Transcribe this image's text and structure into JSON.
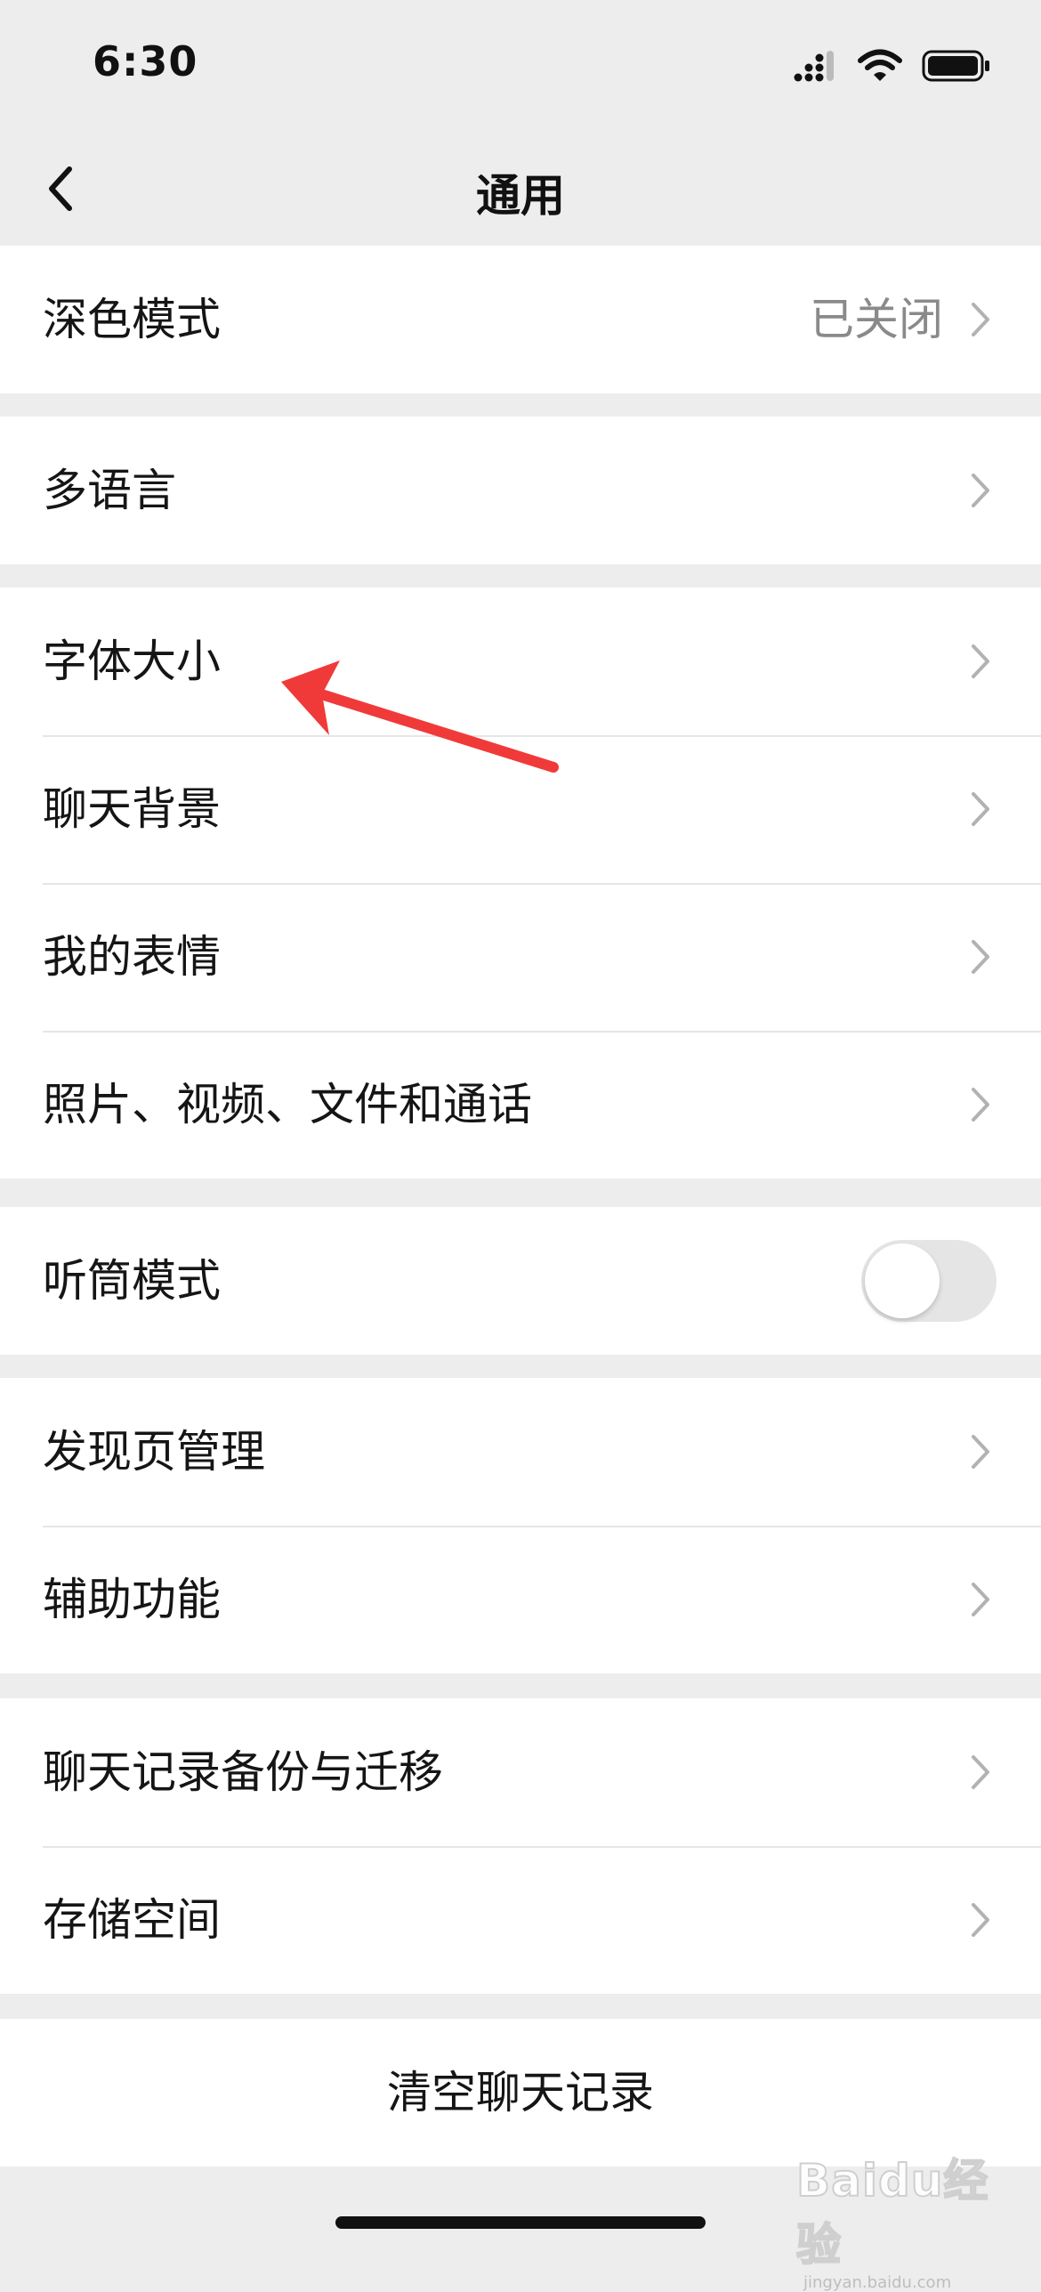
{
  "status_bar": {
    "time": "6:30"
  },
  "nav": {
    "title": "通用"
  },
  "groups": [
    {
      "items": [
        {
          "label": "深色模式",
          "value": "已关闭"
        }
      ]
    },
    {
      "items": [
        {
          "label": "多语言"
        }
      ]
    },
    {
      "items": [
        {
          "label": "字体大小"
        },
        {
          "label": "聊天背景"
        },
        {
          "label": "我的表情"
        },
        {
          "label": "照片、视频、文件和通话"
        }
      ]
    },
    {
      "items": [
        {
          "label": "听筒模式",
          "toggle": false
        }
      ]
    },
    {
      "items": [
        {
          "label": "发现页管理"
        },
        {
          "label": "辅助功能"
        }
      ]
    },
    {
      "items": [
        {
          "label": "聊天记录备份与迁移"
        },
        {
          "label": "存储空间"
        }
      ]
    }
  ],
  "actions": {
    "clear_chat_history": "清空聊天记录"
  },
  "watermark": {
    "brand": "Baidu经验",
    "site": "jingyan.baidu.com"
  },
  "colors": {
    "background": "#ededed",
    "annotation_arrow": "#f03a3a",
    "secondary_text": "#8a8a8a"
  }
}
